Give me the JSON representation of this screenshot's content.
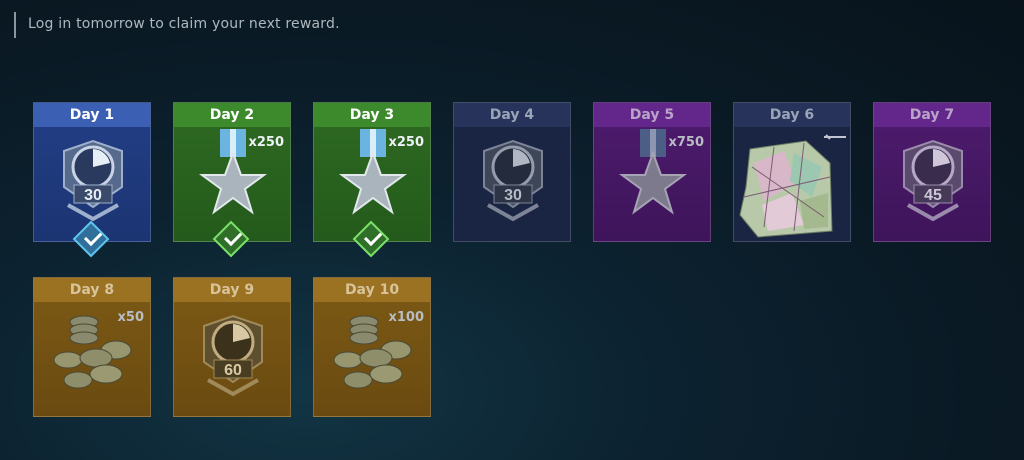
{
  "notice": "Log in tomorrow to claim your next reward.",
  "days": [
    {
      "label": "Day 1",
      "reward": "xp-boost",
      "value": "30",
      "quantity": "",
      "claimed": true,
      "theme": "blue"
    },
    {
      "label": "Day 2",
      "reward": "medal",
      "value": "",
      "quantity": "x250",
      "claimed": true,
      "theme": "green"
    },
    {
      "label": "Day 3",
      "reward": "medal",
      "value": "",
      "quantity": "x250",
      "claimed": true,
      "theme": "green"
    },
    {
      "label": "Day 4",
      "reward": "xp-boost",
      "value": "30",
      "quantity": "",
      "claimed": false,
      "theme": "navy"
    },
    {
      "label": "Day 5",
      "reward": "medal",
      "value": "",
      "quantity": "x750",
      "claimed": false,
      "theme": "purple"
    },
    {
      "label": "Day 6",
      "reward": "weapon-skin",
      "value": "",
      "quantity": "",
      "claimed": false,
      "theme": "navy"
    },
    {
      "label": "Day 7",
      "reward": "xp-boost",
      "value": "45",
      "quantity": "",
      "claimed": false,
      "theme": "purple"
    },
    {
      "label": "Day 8",
      "reward": "coins",
      "value": "",
      "quantity": "x50",
      "claimed": false,
      "theme": "gold"
    },
    {
      "label": "Day 9",
      "reward": "xp-boost",
      "value": "60",
      "quantity": "",
      "claimed": false,
      "theme": "gold"
    },
    {
      "label": "Day 10",
      "reward": "coins",
      "value": "",
      "quantity": "x100",
      "claimed": false,
      "theme": "gold"
    }
  ],
  "colors": {
    "blue": "#3a5fb3",
    "green": "#3c8a2c",
    "navy": "#27335a",
    "purple": "#63268a",
    "gold": "#9a7222"
  }
}
